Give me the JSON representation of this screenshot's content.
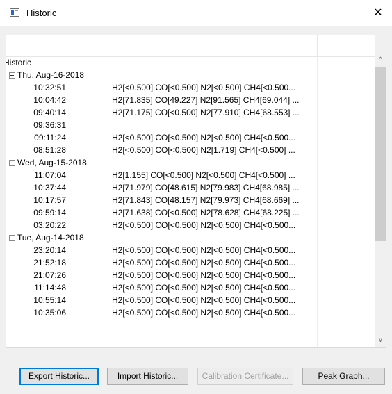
{
  "window": {
    "title": "Historic",
    "close_glyph": "✕",
    "icon": "app-window-icon"
  },
  "tree": {
    "root_label": "Historic",
    "groups": [
      {
        "date": "Thu, Aug-16-2018",
        "rows": [
          {
            "time": "10:32:51",
            "value": "H2[<0.500] CO[<0.500] N2[<0.500] CH4[<0.500..."
          },
          {
            "time": "10:04:42",
            "value": "H2[71.835] CO[49.227] N2[91.565] CH4[69.044] ..."
          },
          {
            "time": "09:40:14",
            "value": "H2[71.175] CO[<0.500] N2[77.910] CH4[68.553] ..."
          },
          {
            "time": "09:36:31",
            "value": ""
          },
          {
            "time": "09:11:24",
            "value": "H2[<0.500] CO[<0.500] N2[<0.500] CH4[<0.500..."
          },
          {
            "time": "08:51:28",
            "value": "H2[<0.500] CO[<0.500] N2[1.719] CH4[<0.500] ..."
          }
        ]
      },
      {
        "date": "Wed, Aug-15-2018",
        "rows": [
          {
            "time": "11:07:04",
            "value": "H2[1.155] CO[<0.500] N2[<0.500] CH4[<0.500] ..."
          },
          {
            "time": "10:37:44",
            "value": "H2[71.979] CO[48.615] N2[79.983] CH4[68.985] ..."
          },
          {
            "time": "10:17:57",
            "value": "H2[71.843] CO[48.157] N2[79.973] CH4[68.669] ..."
          },
          {
            "time": "09:59:14",
            "value": "H2[71.638] CO[<0.500] N2[78.628] CH4[68.225] ..."
          },
          {
            "time": "03:20:22",
            "value": "H2[<0.500] CO[<0.500] N2[<0.500] CH4[<0.500..."
          }
        ]
      },
      {
        "date": "Tue, Aug-14-2018",
        "rows": [
          {
            "time": "23:20:14",
            "value": "H2[<0.500] CO[<0.500] N2[<0.500] CH4[<0.500..."
          },
          {
            "time": "21:52:18",
            "value": "H2[<0.500] CO[<0.500] N2[<0.500] CH4[<0.500..."
          },
          {
            "time": "21:07:26",
            "value": "H2[<0.500] CO[<0.500] N2[<0.500] CH4[<0.500..."
          },
          {
            "time": "11:14:48",
            "value": "H2[<0.500] CO[<0.500] N2[<0.500] CH4[<0.500..."
          },
          {
            "time": "10:55:14",
            "value": "H2[<0.500] CO[<0.500] N2[<0.500] CH4[<0.500..."
          },
          {
            "time": "10:35:06",
            "value": "H2[<0.500] CO[<0.500] N2[<0.500] CH4[<0.500..."
          }
        ]
      }
    ]
  },
  "scrollbar": {
    "up_glyph": "^",
    "down_glyph": "v"
  },
  "buttons": {
    "export": "Export Historic...",
    "import": "Import Historic...",
    "calibration": "Calibration Certificate...",
    "peak": "Peak Graph..."
  },
  "colors": {
    "accent": "#0078d7",
    "disabled_text": "#a0a0a0",
    "button_face": "#e1e1e1"
  }
}
